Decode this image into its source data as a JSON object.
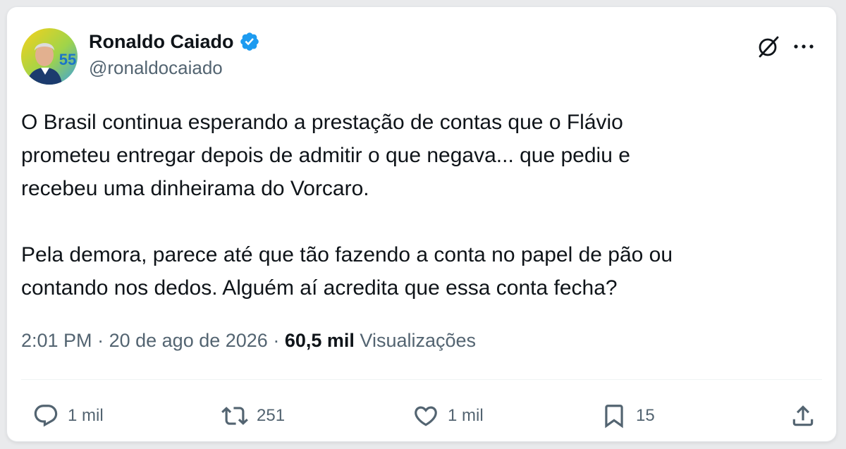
{
  "author": {
    "display_name": "Ronaldo Caiado",
    "handle": "@ronaldocaiado",
    "verified": true,
    "avatar_badge_text": "55"
  },
  "tweet": {
    "text": "O Brasil continua esperando a prestação de contas que o Flávio\nprometeu entregar depois de admitir o que negava... que pediu e\nrecebeu uma dinheirama do Vorcaro.\n\nPela demora, parece até que tão fazendo a conta no papel de pão ou\ncontando nos dedos. Alguém aí acredita que essa conta fecha?",
    "time": "2:01 PM",
    "separator": "·",
    "date": "20 de ago de 2026",
    "views_count": "60,5 mil",
    "views_label": "Visualizações"
  },
  "actions": {
    "replies": "1 mil",
    "retweets": "251",
    "likes": "1 mil",
    "bookmarks": "15"
  },
  "icons": {
    "grok": "grok-icon",
    "more": "more-icon",
    "reply": "reply-icon",
    "retweet": "retweet-icon",
    "like": "heart-icon",
    "bookmark": "bookmark-icon",
    "share": "share-icon",
    "verified": "verified-badge-icon"
  },
  "colors": {
    "text_primary": "#0f1419",
    "text_secondary": "#536471",
    "verified_blue": "#1d9bf0",
    "divider": "#eff3f4"
  }
}
